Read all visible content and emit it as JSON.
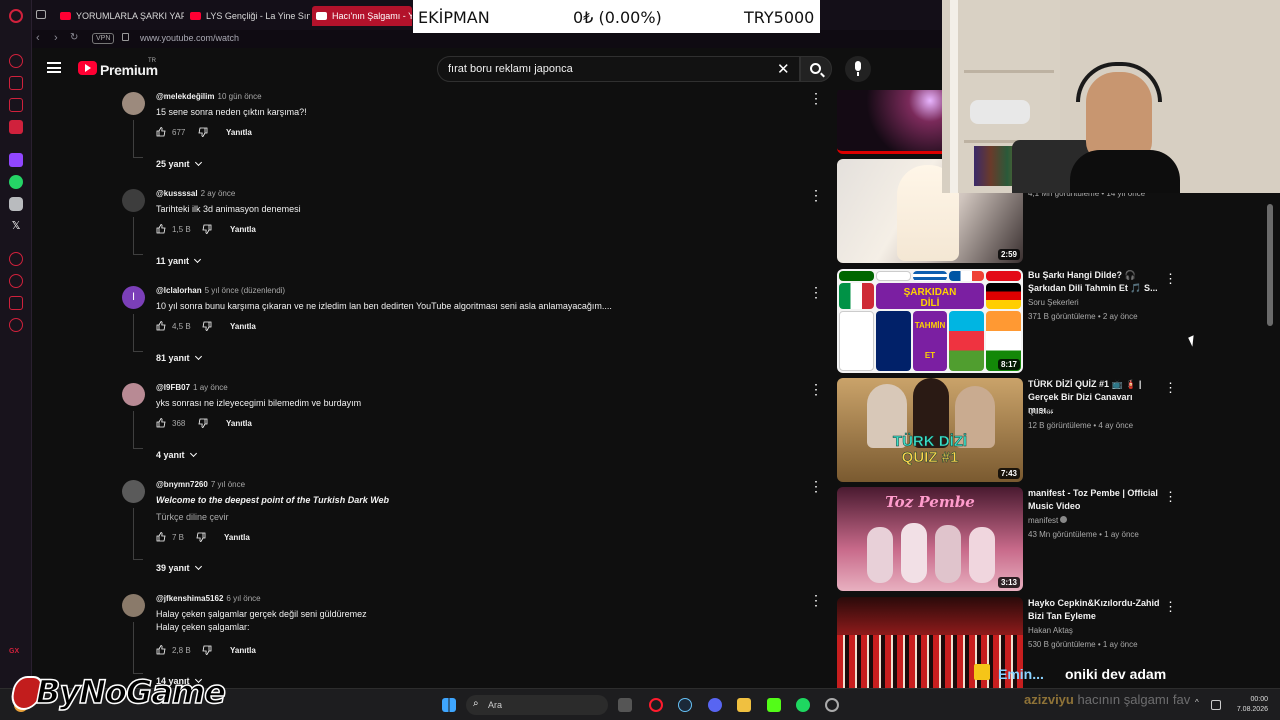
{
  "browser": {
    "tabs": [
      {
        "label": "YORUMLARLA ŞARKI YAPTIK"
      },
      {
        "label": "LYS Gençliği - La Yine Sınav"
      },
      {
        "label": "Hacı'nın Şalgamı - YouTube"
      }
    ],
    "url": "www.youtube.com/watch",
    "vpn_label": "VPN"
  },
  "overlay": {
    "item": "EKİPMAN",
    "change": "0₺ (0.00%)",
    "price": "TRY5000"
  },
  "youtube": {
    "brand": "Premium",
    "country": "TR",
    "search_value": "fırat boru reklamı japonca",
    "search_placeholder": "Ara"
  },
  "comments": [
    {
      "author": "@melekdeğilim",
      "time": "10 gün önce",
      "text": "15 sene sonra neden çıktın karşıma?!",
      "likes": "677",
      "reply": "Yanıtla",
      "replies": "25 yanıt"
    },
    {
      "author": "@kussssal",
      "time": "2 ay önce",
      "text": "Tarihteki ilk 3d animasyon denemesi",
      "likes": "1,5 B",
      "reply": "Yanıtla",
      "replies": "11 yanıt"
    },
    {
      "author": "@lclalorhan",
      "time": "5 yıl önce (düzenlendi)",
      "text": "10 yıl sonra bunu karşıma çıkaran ve ne izledim lan ben dedirten YouTube algoritması seni asla anlamayacağım....",
      "likes": "4,5 B",
      "reply": "Yanıtla",
      "replies": "81 yanıt",
      "avatar_letter": "I"
    },
    {
      "author": "@l9FB07",
      "time": "1 ay önce",
      "text": "yks sonrası ne izleyecegimi bilemedim ve burdayım",
      "likes": "368",
      "reply": "Yanıtla",
      "replies": "4 yanıt"
    },
    {
      "author": "@bnymn7260",
      "time": "7 yıl önce",
      "text": "Welcome to the deepest point of the Turkish Dark Web",
      "translate": "Türkçe diline çevir",
      "likes": "7 B",
      "reply": "Yanıtla",
      "replies": "39 yanıt"
    },
    {
      "author": "@jfkenshima5162",
      "time": "6 yıl önce",
      "text": "Halay çeken şalgamlar gerçek değil seni güldüremez",
      "text2": "Halay çeken şalgamlar:",
      "likes": "2,8 B",
      "reply": "Yanıtla",
      "replies": "14 yanıt"
    }
  ],
  "recommendations": [
    {
      "title": "",
      "channel": "",
      "meta": "4,1 Mn görüntüleme • 14 yıl önce",
      "duration": "2:59"
    },
    {
      "title": "Bu Şarkı Hangi Dilde? 🎧 Şarkıdan Dili Tahmin Et 🎵 S...",
      "channel": "Soru Şekerleri",
      "meta": "371 B görüntüleme • 2 ay önce",
      "duration": "8:17",
      "thumb_text": [
        "ŞARKIDAN",
        "DİLİ",
        "TAHMİN ET"
      ]
    },
    {
      "title": "TÜRK DİZİ QUİZ #1 📺 🧯 | Gerçek Bir Dizi Canavarı mısı...",
      "channel": "Quizler",
      "meta": "12 B görüntüleme • 4 ay önce",
      "duration": "7:43",
      "thumb_text": [
        "TÜRK DİZİ",
        "QUIZ #1"
      ]
    },
    {
      "title": "manifest - Toz Pembe | Official Music Video",
      "channel": "manifest",
      "meta": "43 Mn görüntüleme • 1 ay önce",
      "duration": "3:13",
      "thumb_text": [
        "Toz Pembe"
      ]
    },
    {
      "title": "Hayko Cepkin&Kızılordu-Zahid Bizi Tan Eyleme",
      "channel": "Hakan Aktaş",
      "meta": "530 B görüntüleme • 1 ay önce",
      "duration": ""
    }
  ],
  "stream": {
    "watermark": "ByNoGame",
    "chat_user": "Emin...",
    "chat_msg": "oniki dev adam",
    "chat2_user": "azizviyu",
    "chat2_msg": "hacının şalgamı fav"
  },
  "taskbar": {
    "search": "Ara",
    "time": "00:00",
    "date": "7.08.2026"
  },
  "colors": {
    "accent": "#ff0033",
    "background": "#0f0f0f",
    "opera_red": "#b3122b"
  }
}
